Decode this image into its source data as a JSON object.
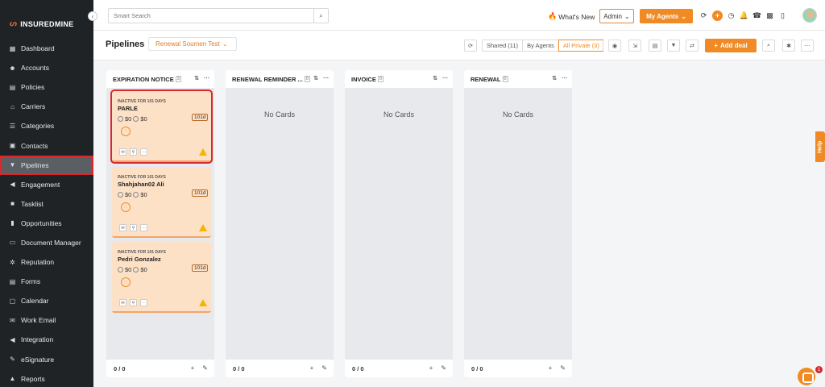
{
  "brand": {
    "name": "INSUREDMINE"
  },
  "sidebar": {
    "items": [
      {
        "label": "Dashboard",
        "icon": "dashboard-icon"
      },
      {
        "label": "Accounts",
        "icon": "accounts-icon"
      },
      {
        "label": "Policies",
        "icon": "policies-icon"
      },
      {
        "label": "Carriers",
        "icon": "carriers-icon"
      },
      {
        "label": "Categories",
        "icon": "categories-icon"
      },
      {
        "label": "Contacts",
        "icon": "contacts-icon"
      },
      {
        "label": "Pipelines",
        "icon": "pipelines-icon",
        "active": true
      },
      {
        "label": "Engagement",
        "icon": "engagement-icon"
      },
      {
        "label": "Tasklist",
        "icon": "tasklist-icon"
      },
      {
        "label": "Opportunities",
        "icon": "opportunities-icon"
      },
      {
        "label": "Document Manager",
        "icon": "folder-icon"
      },
      {
        "label": "Reputation",
        "icon": "reputation-icon"
      },
      {
        "label": "Forms",
        "icon": "forms-icon"
      },
      {
        "label": "Calendar",
        "icon": "calendar-icon"
      },
      {
        "label": "Work Email",
        "icon": "email-icon"
      },
      {
        "label": "Integration",
        "icon": "integration-icon"
      },
      {
        "label": "eSignature",
        "icon": "signature-icon"
      },
      {
        "label": "Reports",
        "icon": "reports-icon"
      }
    ]
  },
  "topbar": {
    "search_placeholder": "Smart Search",
    "whats_new": "What's New",
    "role": "Admin",
    "agents_label": "My Agents"
  },
  "subheader": {
    "title": "Pipelines",
    "pipeline_name": "Renewal Soumen Test",
    "filters": [
      "Shared (11)",
      "By Agents",
      "All Private (3)"
    ],
    "add_deal": "Add deal"
  },
  "board": {
    "columns": [
      {
        "title": "EXPIRATION NOTICE",
        "count": "3",
        "footer": "0 / 0",
        "empty_text": ""
      },
      {
        "title": "RENEWAL REMINDER ...",
        "count": "0",
        "footer": "0 / 0",
        "empty_text": "No Cards"
      },
      {
        "title": "INVOICE",
        "count": "0",
        "footer": "0 / 0",
        "empty_text": "No Cards"
      },
      {
        "title": "RENEWAL",
        "count": "0",
        "footer": "0 / 0",
        "empty_text": "No Cards"
      }
    ],
    "cards": [
      {
        "status": "INACTIVE FOR 101 DAYS",
        "name": "PARLE",
        "amount1": "$0",
        "amount2": "$0",
        "days": "101d"
      },
      {
        "status": "INACTIVE FOR 101 DAYS",
        "name": "Shahjahan02 Ali",
        "amount1": "$0",
        "amount2": "$0",
        "days": "101d"
      },
      {
        "status": "INACTIVE FOR 101 DAYS",
        "name": "Pedri Gonzalez",
        "amount1": "$0",
        "amount2": "$0",
        "days": "101d"
      }
    ]
  },
  "help_label": "Help",
  "chat_badge": "1",
  "colors": {
    "accent": "#f08a24",
    "sidebar_bg": "#1f2326",
    "card_bg": "#fde1c6",
    "highlight": "#d8282c"
  }
}
